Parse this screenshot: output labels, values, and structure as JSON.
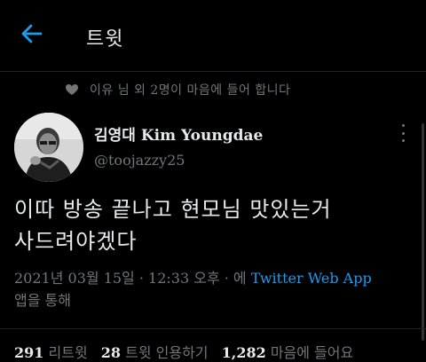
{
  "header": {
    "title": "트윗"
  },
  "social_context": {
    "text": "이유 님 외 2명이 마음에 들어 합니다"
  },
  "tweet": {
    "display_name": "김영대 Kim Youngdae",
    "handle": "@toojazzy25",
    "text_line1": "이따 방송 끝나고 현모님 맛있는거",
    "text_line2": "사드려야겠다",
    "timestamp": "2021년 03월 15일 · 12:33 오후 · 에",
    "source": "Twitter Web App",
    "source_suffix": "앱을 통해"
  },
  "stats": {
    "retweets_count": "291",
    "retweets_label": "리트윗",
    "quotes_count": "28",
    "quotes_label": "트윗 인용하기",
    "likes_count": "1,282",
    "likes_label": "마음에 들어요"
  },
  "colors": {
    "background": "#000000",
    "accent": "#1d9bf0",
    "secondary_text": "#71767b",
    "primary_text": "#e7e9ea"
  },
  "icons": {
    "back": "arrow-left-icon",
    "like": "heart-icon",
    "more": "more-vertical-icon"
  }
}
